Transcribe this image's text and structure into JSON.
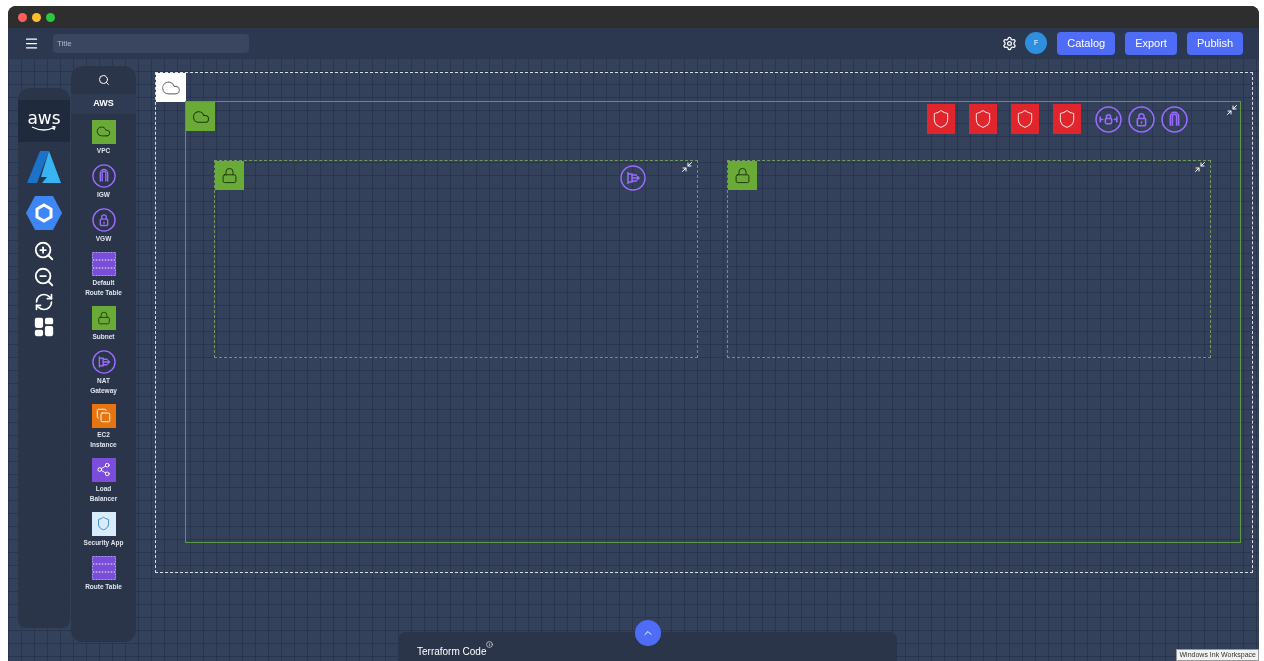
{
  "toolbar": {
    "title_field": {
      "placeholder": "Title"
    },
    "avatar": "F",
    "buttons": [
      "Catalog",
      "Export",
      "Publish"
    ]
  },
  "providers": [
    {
      "kind": "aws",
      "label": "aws",
      "selected": true
    },
    {
      "kind": "azure",
      "selected": false
    },
    {
      "kind": "gcp",
      "selected": false
    }
  ],
  "palette": {
    "heading": "AWS",
    "items": [
      {
        "kind": "vpc",
        "label": "VPC"
      },
      {
        "kind": "igw",
        "label": "IGW"
      },
      {
        "kind": "vgw",
        "label": "VGW"
      },
      {
        "kind": "route_table",
        "label": "Default Route Table"
      },
      {
        "kind": "subnet",
        "label": "Subnet"
      },
      {
        "kind": "nat",
        "label": "NAT Gateway"
      },
      {
        "kind": "ec2",
        "label": "EC2 Instance"
      },
      {
        "kind": "load_balancer",
        "label": "Load Balancer"
      },
      {
        "kind": "security_app",
        "label": "Security App"
      },
      {
        "kind": "route_table",
        "label": "Route Table"
      }
    ]
  },
  "canvas": {
    "vpc": {
      "controls": [
        {
          "kind": "firewall"
        },
        {
          "kind": "firewall"
        },
        {
          "kind": "firewall"
        },
        {
          "kind": "firewall"
        },
        {
          "kind": "vpn"
        },
        {
          "kind": "vgw"
        },
        {
          "kind": "igw"
        }
      ]
    },
    "subnets": [
      {
        "kind": "subnet",
        "nodes": [
          {
            "kind": "nat"
          }
        ]
      },
      {
        "kind": "subnet"
      }
    ]
  },
  "drawer": {
    "label": "Terraform Code"
  },
  "os_tooltip": "Windows Ink Workspace"
}
